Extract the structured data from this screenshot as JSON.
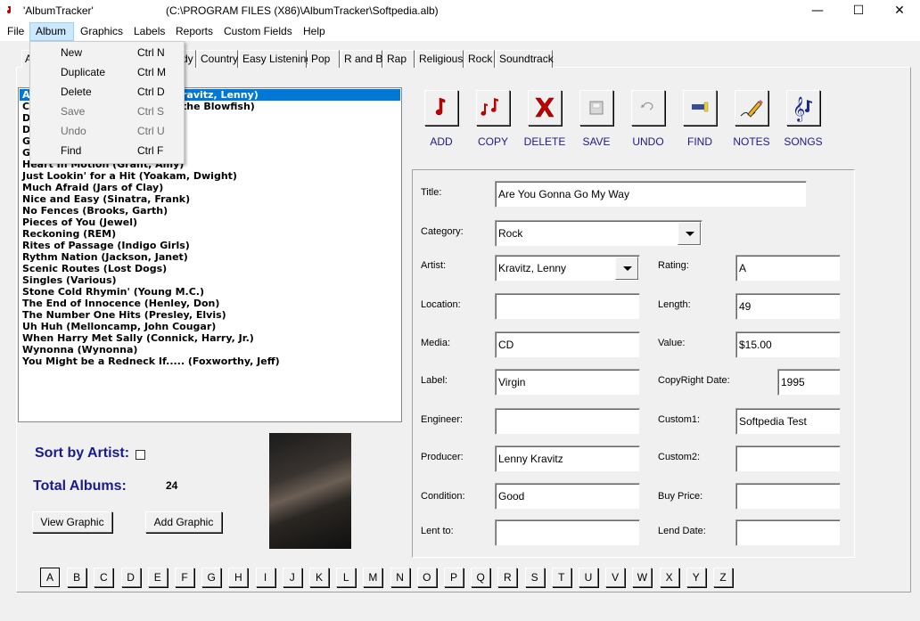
{
  "window": {
    "app_title": "'AlbumTracker'",
    "file_path": "(C:\\PROGRAM FILES (X86)\\AlbumTracker\\Softpedia.alb)",
    "minimize": "—",
    "maximize": "☐",
    "close": "✕"
  },
  "menubar": [
    "File",
    "Album",
    "Graphics",
    "Labels",
    "Reports",
    "Custom Fields",
    "Help"
  ],
  "album_menu": [
    {
      "label": "New",
      "shortcut": "Ctrl N",
      "enabled": true
    },
    {
      "label": "Duplicate",
      "shortcut": "Ctrl M",
      "enabled": true
    },
    {
      "label": "Delete",
      "shortcut": "Ctrl D",
      "enabled": true
    },
    {
      "label": "Save",
      "shortcut": "Ctrl S",
      "enabled": false
    },
    {
      "label": "Undo",
      "shortcut": "Ctrl U",
      "enabled": false
    },
    {
      "label": "Find",
      "shortcut": "Ctrl F",
      "enabled": true
    }
  ],
  "tabs": [
    "dy",
    "Country",
    "Easy Listening",
    "Pop",
    "R and B",
    "Rap",
    "Religious",
    "Rock",
    "Soundtrack"
  ],
  "album_list": {
    "selected_index": 0,
    "items": [
      "A",
      "C",
      "D",
      "D",
      "G",
      "G",
      "Heart In Motion (Grant, Amy)",
      "Just Lookin' for a Hit (Yoakam, Dwight)",
      "Much Afraid (Jars of Clay)",
      "Nice and Easy (Sinatra, Frank)",
      "No Fences (Brooks, Garth)",
      "Pieces of You (Jewel)",
      "Reckoning (REM)",
      "Rites of Passage (Indigo Girls)",
      "Rythm Nation (Jackson, Janet)",
      "Scenic Routes (Lost Dogs)",
      "Singles (Various)",
      "Stone Cold Rhymin' (Young M.C.)",
      "The End of Innocence (Henley, Don)",
      "The Number One Hits (Presley, Elvis)",
      "Uh Huh (Melloncamp, John Cougar)",
      "When Harry Met Sally (Connick, Harry, Jr.)",
      "Wynonna (Wynonna)",
      "You Might be a Redneck If..... (Foxworthy, Jeff)"
    ],
    "partial_right": [
      "ravitz, Lenny)",
      "the Blowfish)"
    ]
  },
  "toolbar": [
    {
      "label": "ADD",
      "icon": "music-note-icon"
    },
    {
      "label": "COPY",
      "icon": "music-notes-icon"
    },
    {
      "label": "DELETE",
      "icon": "red-x-icon"
    },
    {
      "label": "SAVE",
      "icon": "floppy-icon"
    },
    {
      "label": "UNDO",
      "icon": "undo-arrow-icon"
    },
    {
      "label": "FIND",
      "icon": "flashlight-icon"
    },
    {
      "label": "NOTES",
      "icon": "pencil-icon"
    },
    {
      "label": "SONGS",
      "icon": "treble-clef-icon"
    }
  ],
  "form": {
    "title": {
      "label": "Title:",
      "value": "Are You Gonna Go My Way"
    },
    "category": {
      "label": "Category:",
      "value": "Rock"
    },
    "artist": {
      "label": "Artist:",
      "value": "Kravitz, Lenny"
    },
    "rating": {
      "label": "Rating:",
      "value": "A"
    },
    "location": {
      "label": "Location:",
      "value": ""
    },
    "length": {
      "label": "Length:",
      "value": "49"
    },
    "media": {
      "label": "Media:",
      "value": "CD"
    },
    "value": {
      "label": "Value:",
      "value": "$15.00"
    },
    "label": {
      "label": "Label:",
      "value": "Virgin"
    },
    "copyright": {
      "label": "CopyRight Date:",
      "value": "1995"
    },
    "engineer": {
      "label": "Engineer:",
      "value": ""
    },
    "custom1": {
      "label": "Custom1:",
      "value": "Softpedia Test"
    },
    "producer": {
      "label": "Producer:",
      "value": "Lenny Kravitz"
    },
    "custom2": {
      "label": "Custom2:",
      "value": ""
    },
    "condition": {
      "label": "Condition:",
      "value": "Good"
    },
    "buy_price": {
      "label": "Buy Price:",
      "value": ""
    },
    "lent_to": {
      "label": "Lent to:",
      "value": ""
    },
    "lend_date": {
      "label": "Lend Date:",
      "value": ""
    }
  },
  "sort_by_artist": {
    "label": "Sort by Artist:",
    "checked": false
  },
  "total_albums": {
    "label": "Total Albums:",
    "value": "24"
  },
  "buttons": {
    "view_graphic": "View Graphic",
    "add_graphic": "Add Graphic"
  },
  "letters": [
    "A",
    "B",
    "C",
    "D",
    "E",
    "F",
    "G",
    "H",
    "I",
    "J",
    "K",
    "L",
    "M",
    "N",
    "O",
    "P",
    "Q",
    "R",
    "S",
    "T",
    "U",
    "V",
    "W",
    "X",
    "Y",
    "Z"
  ],
  "active_letter": "A",
  "colors": {
    "accent_blue": "#1a1a8c",
    "selection": "#0078d7",
    "icon_red": "#c00000"
  }
}
